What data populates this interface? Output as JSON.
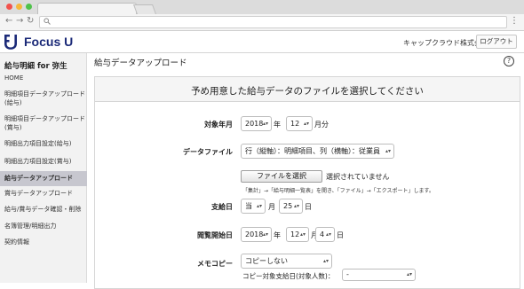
{
  "browser": {
    "search_icon": "search-icon",
    "menu_icon": "more-vert-icon"
  },
  "header": {
    "logo_text": "Focus U",
    "company": "キャップクラウド株式会社",
    "logout": "ログアウト"
  },
  "sidebar": {
    "title": "給与明細 for 弥生",
    "items": [
      {
        "label": "HOME"
      },
      {
        "label": "明細項目データアップロード"
      },
      {
        "label": "(給与)"
      },
      {
        "label": "明細項目データアップロード"
      },
      {
        "label": "(賞与)"
      },
      {
        "label": "明細出力項目設定(給与)"
      },
      {
        "label": "明細出力項目設定(賞与)"
      },
      {
        "label": "給与データアップロード"
      },
      {
        "label": "賞与データアップロード"
      },
      {
        "label": "給与/賞与データ確認・削除"
      },
      {
        "label": "名簿管理/明細出力"
      },
      {
        "label": "契約情報"
      }
    ],
    "active_index": 7
  },
  "main": {
    "page_title": "給与データアップロード",
    "help": "?",
    "panel_title": "予め用意した給与データのファイルを選択してください",
    "target_month": {
      "label": "対象年月",
      "year": "2018",
      "year_unit": "年",
      "month": "12",
      "month_unit": "月分"
    },
    "data_file": {
      "label": "データファイル",
      "format": "行（縦軸）：明細項目、列（横軸）：従業員",
      "file_button": "ファイルを選択",
      "file_status": "選択されていません",
      "hint": "「集計」→「給与明細一覧表」を開き、「ファイル」→「エクスポート」します。"
    },
    "pay_date": {
      "label": "支給日",
      "month": "当",
      "month_unit": "月",
      "day": "25",
      "day_unit": "日"
    },
    "view_start": {
      "label": "閲覧開始日",
      "year": "2018",
      "year_unit": "年",
      "month": "12",
      "month_unit": "月",
      "day": "4",
      "day_unit": "日"
    },
    "memo_copy": {
      "label": "メモコピー",
      "value": "コピーしない",
      "copy_target_label": "コピー対象支給日(対象人数)：",
      "copy_target_value": "-"
    }
  },
  "colors": {
    "brand": "#1b2a78",
    "active_item_bg": "#c7c7cf"
  }
}
